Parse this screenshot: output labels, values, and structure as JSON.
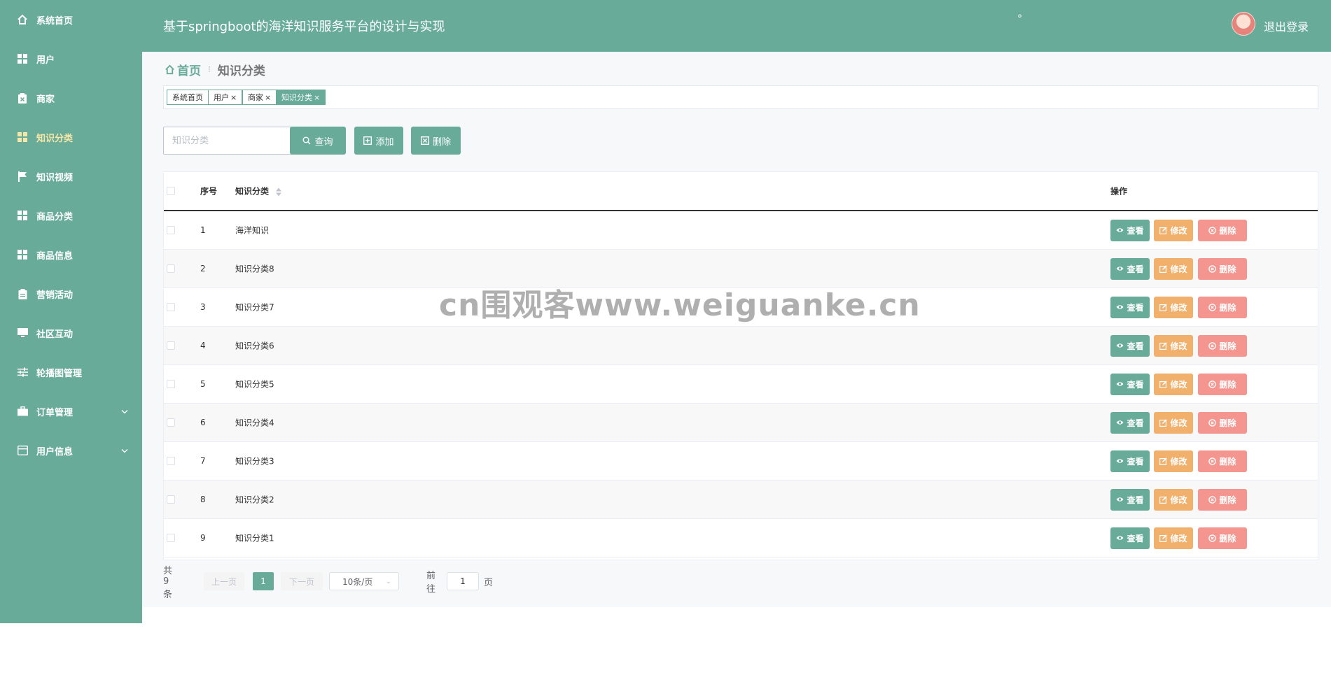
{
  "colors": {
    "primary": "#67ab98",
    "edit": "#f1b06b",
    "delete": "#f4958f",
    "active_menu": "#f6e6a8"
  },
  "sidebar": {
    "items": [
      {
        "label": "系统首页",
        "icon": "home-icon",
        "active": false
      },
      {
        "label": "用户",
        "icon": "grid-icon",
        "active": false
      },
      {
        "label": "商家",
        "icon": "clipboard-x-icon",
        "active": false
      },
      {
        "label": "知识分类",
        "icon": "grid-icon",
        "active": true
      },
      {
        "label": "知识视频",
        "icon": "flag-icon",
        "active": false
      },
      {
        "label": "商品分类",
        "icon": "grid-icon",
        "active": false
      },
      {
        "label": "商品信息",
        "icon": "grid-icon",
        "active": false
      },
      {
        "label": "营销活动",
        "icon": "clipboard-icon",
        "active": false
      },
      {
        "label": "社区互动",
        "icon": "monitor-icon",
        "active": false
      },
      {
        "label": "轮播图管理",
        "icon": "sliders-icon",
        "active": false
      },
      {
        "label": "订单管理",
        "icon": "briefcase-icon",
        "active": false,
        "expandable": true
      },
      {
        "label": "用户信息",
        "icon": "card-icon",
        "active": false,
        "expandable": true
      }
    ]
  },
  "header": {
    "title": "基于springboot的海洋知识服务平台的设计与实现",
    "dot": "°",
    "logout": "退出登录"
  },
  "breadcrumb": {
    "home": "首页",
    "separator": "⁝",
    "current": "知识分类"
  },
  "tags": [
    {
      "label": "系统首页",
      "closable": false,
      "active": false
    },
    {
      "label": "用户",
      "closable": true,
      "active": false
    },
    {
      "label": "商家",
      "closable": true,
      "active": false
    },
    {
      "label": "知识分类",
      "closable": true,
      "active": true
    }
  ],
  "tag_close": "×",
  "search": {
    "placeholder": "知识分类",
    "value": ""
  },
  "toolbar": {
    "query_label": "查询",
    "add_label": "添加",
    "delete_label": "删除"
  },
  "table": {
    "columns": {
      "index": "序号",
      "name": "知识分类",
      "actions": "操作"
    },
    "actions": {
      "view": "查看",
      "edit": "修改",
      "delete": "删除"
    },
    "rows": [
      {
        "index": "1",
        "name": "海洋知识"
      },
      {
        "index": "2",
        "name": "知识分类8"
      },
      {
        "index": "3",
        "name": "知识分类7"
      },
      {
        "index": "4",
        "name": "知识分类6"
      },
      {
        "index": "5",
        "name": "知识分类5"
      },
      {
        "index": "6",
        "name": "知识分类4"
      },
      {
        "index": "7",
        "name": "知识分类3"
      },
      {
        "index": "8",
        "name": "知识分类2"
      },
      {
        "index": "9",
        "name": "知识分类1"
      }
    ]
  },
  "pagination": {
    "total": "共 9 条",
    "prev": "上一页",
    "page": "1",
    "next": "下一页",
    "page_size": "10条/页",
    "goto_label": "前往",
    "goto_value": "1",
    "goto_suffix": "页"
  },
  "watermark": "cn围观客www.weiguanke.cn"
}
